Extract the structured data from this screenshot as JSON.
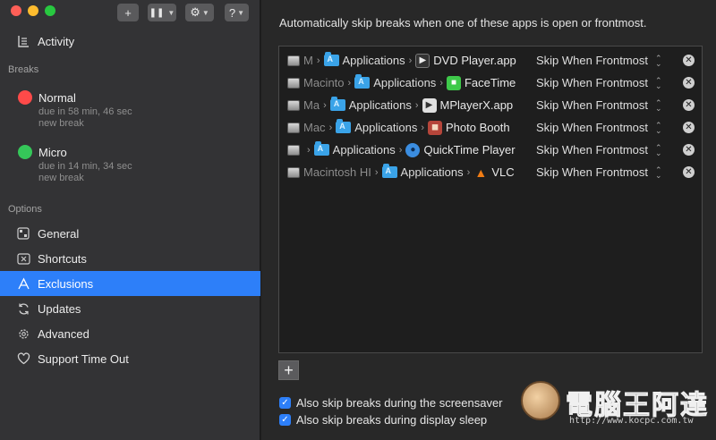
{
  "sidebar": {
    "nav_top": {
      "label": "Activity",
      "icon": "activity-icon"
    },
    "breaks_heading": "Breaks",
    "breaks": [
      {
        "name": "Normal",
        "due": "due in 58 min, 46 sec",
        "next": "new break",
        "color": "#fe4a49"
      },
      {
        "name": "Micro",
        "due": "due in 14 min, 34 sec",
        "next": "new break",
        "color": "#35c759"
      }
    ],
    "options_heading": "Options",
    "options": [
      {
        "label": "General",
        "icon": "general-icon"
      },
      {
        "label": "Shortcuts",
        "icon": "shortcuts-icon"
      },
      {
        "label": "Exclusions",
        "icon": "exclusions-icon",
        "active": true
      },
      {
        "label": "Updates",
        "icon": "updates-icon"
      },
      {
        "label": "Advanced",
        "icon": "advanced-icon"
      },
      {
        "label": "Support Time Out",
        "icon": "heart-icon"
      }
    ]
  },
  "toolbar": {
    "add": "+",
    "pause": "❚❚",
    "gear": "⚙",
    "help": "?"
  },
  "main": {
    "heading": "Automatically skip breaks when one of these apps is open or frontmost.",
    "exclusions": [
      {
        "volume": "M",
        "folder": "Applications",
        "app": "DVD Player.app",
        "mode": "Skip When Frontmost",
        "icon": "dvd-player-icon",
        "icon_color": "#333333",
        "glyph": "▶"
      },
      {
        "volume": "Macinto",
        "folder": "Applications",
        "app": "FaceTime",
        "mode": "Skip When Frontmost",
        "icon": "facetime-icon",
        "icon_color": "#3ec94a",
        "glyph": "■"
      },
      {
        "volume": "Ma",
        "folder": "Applications",
        "app": "MPlayerX.app",
        "mode": "Skip When Frontmost",
        "icon": "mplayerx-icon",
        "icon_color": "#e0e0e0",
        "glyph": "▶"
      },
      {
        "volume": "Mac",
        "folder": "Applications",
        "app": "Photo Booth",
        "mode": "Skip When Frontmost",
        "icon": "photo-booth-icon",
        "icon_color": "#b5453a",
        "glyph": "◼"
      },
      {
        "volume": "",
        "folder": "Applications",
        "app": "QuickTime Player",
        "mode": "Skip When Frontmost",
        "icon": "quicktime-icon",
        "icon_color": "#3b8de0",
        "glyph": "●"
      },
      {
        "volume": "Macintosh HI",
        "folder": "Applications",
        "app": "VLC",
        "mode": "Skip When Frontmost",
        "icon": "vlc-icon",
        "icon_color": "#f07c14",
        "glyph": "▲"
      }
    ],
    "add_button": "+",
    "screensaver_label": "Also skip breaks during the screensaver",
    "display_sleep_label": "Also skip breaks during display sleep"
  },
  "watermark": {
    "text": "電腦王阿達",
    "url": "http://www.kocpc.com.tw"
  }
}
